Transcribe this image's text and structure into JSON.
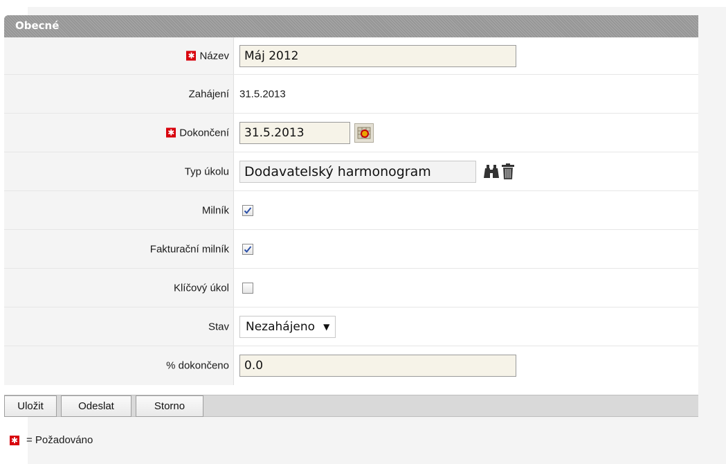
{
  "section": {
    "title": "Obecné"
  },
  "fields": {
    "name": {
      "label": "Název",
      "value": "Máj 2012",
      "required": true
    },
    "start": {
      "label": "Zahájení",
      "value": "31.5.2013"
    },
    "end": {
      "label": "Dokončení",
      "value": "31.5.2013",
      "required": true
    },
    "task_type": {
      "label": "Typ úkolu",
      "value": "Dodavatelský harmonogram"
    },
    "milestone": {
      "label": "Milník",
      "checked": true
    },
    "billing_milestone": {
      "label": "Fakturační milník",
      "checked": true
    },
    "key_task": {
      "label": "Klíčový úkol",
      "checked": false
    },
    "status": {
      "label": "Stav",
      "value": "Nezahájeno"
    },
    "percent_complete": {
      "label": "% dokončeno",
      "value": "0.0"
    }
  },
  "buttons": {
    "save": "Uložit",
    "send": "Odeslat",
    "cancel": "Storno"
  },
  "legend": {
    "text": "= Požadováno"
  },
  "icons": {
    "required": "asterisk-icon",
    "calendar": "calendar-icon",
    "lookup": "binoculars-icon",
    "clear": "trash-icon",
    "dropdown": "chevron-down-icon"
  },
  "colors": {
    "required_marker": "#d8000c",
    "header": "#9e9e9e"
  }
}
